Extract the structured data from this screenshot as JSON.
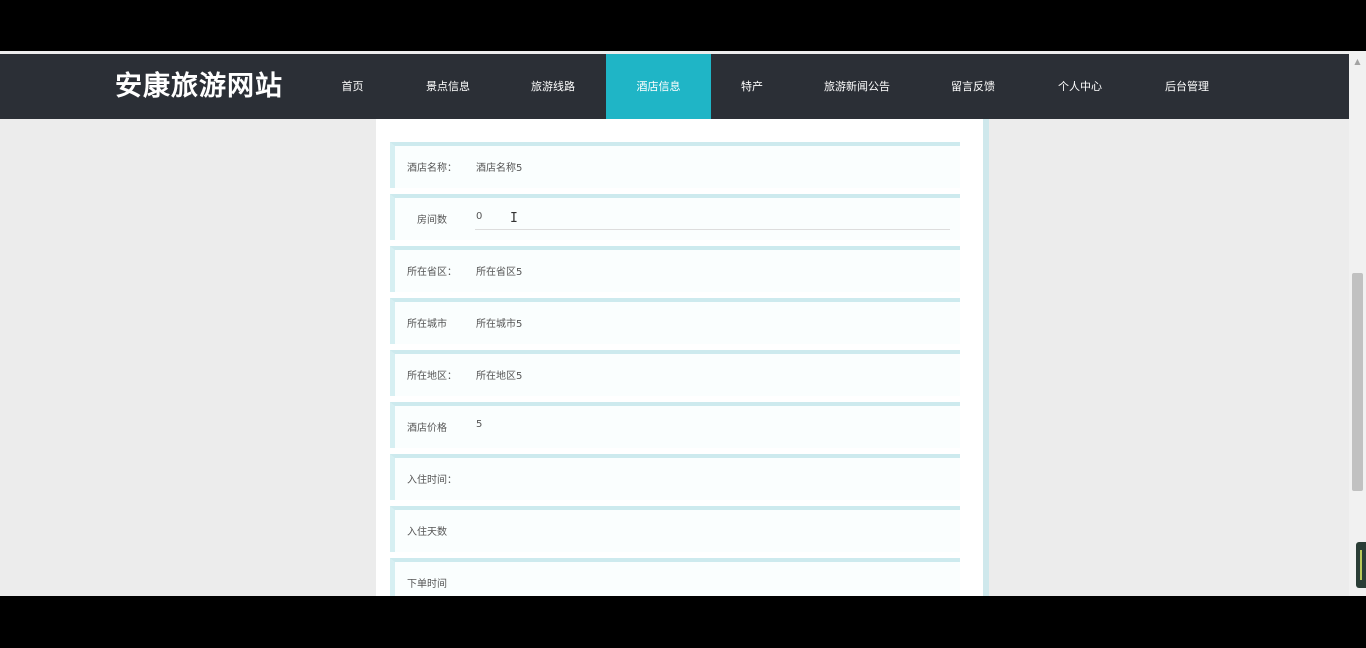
{
  "site": {
    "brand": "安康旅游网站"
  },
  "nav": {
    "items": [
      {
        "label": "首页",
        "active": false
      },
      {
        "label": "景点信息",
        "active": false
      },
      {
        "label": "旅游线路",
        "active": false
      },
      {
        "label": "酒店信息",
        "active": true
      },
      {
        "label": "特产",
        "active": false
      },
      {
        "label": "旅游新闻公告",
        "active": false
      },
      {
        "label": "留言反馈",
        "active": false
      },
      {
        "label": "个人中心",
        "active": false
      },
      {
        "label": "后台管理",
        "active": false
      }
    ]
  },
  "form": {
    "rows": [
      {
        "label": "酒店名称：",
        "value": "酒店名称5"
      },
      {
        "label": "房间数",
        "value": "0"
      },
      {
        "label": "所在省区：",
        "value": "所在省区5"
      },
      {
        "label": "所在城市",
        "value": "所在城市5"
      },
      {
        "label": "所在地区：",
        "value": "所在地区5"
      },
      {
        "label": "酒店价格",
        "value": "5"
      },
      {
        "label": "入住时间：",
        "value": ""
      },
      {
        "label": "入住天数",
        "value": ""
      },
      {
        "label": "下单时间",
        "value": ""
      }
    ]
  },
  "colors": {
    "nav_bg": "#2b2f36",
    "accent": "#1fb5c6",
    "page_bg": "#ececec"
  }
}
